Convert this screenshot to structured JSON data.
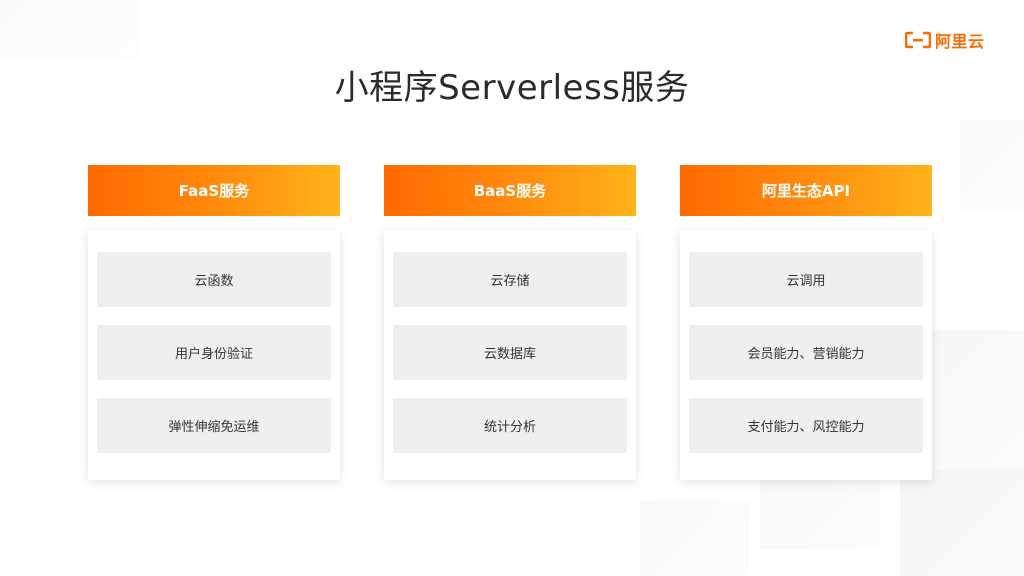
{
  "brand": {
    "logo_text": "阿里云",
    "logo_color": "#ff6a00"
  },
  "title": "小程序Serverless服务",
  "colors": {
    "header_start": "#ff6a00",
    "header_end": "#ffb31a",
    "item_bg": "#efefef"
  },
  "cards": [
    {
      "header": "FaaS服务",
      "items": [
        "云函数",
        "用户身份验证",
        "弹性伸缩免运维"
      ]
    },
    {
      "header": "BaaS服务",
      "items": [
        "云存储",
        "云数据库",
        "统计分析"
      ]
    },
    {
      "header": "阿里生态API",
      "items": [
        "云调用",
        "会员能力、营销能力",
        "支付能力、风控能力"
      ]
    }
  ]
}
